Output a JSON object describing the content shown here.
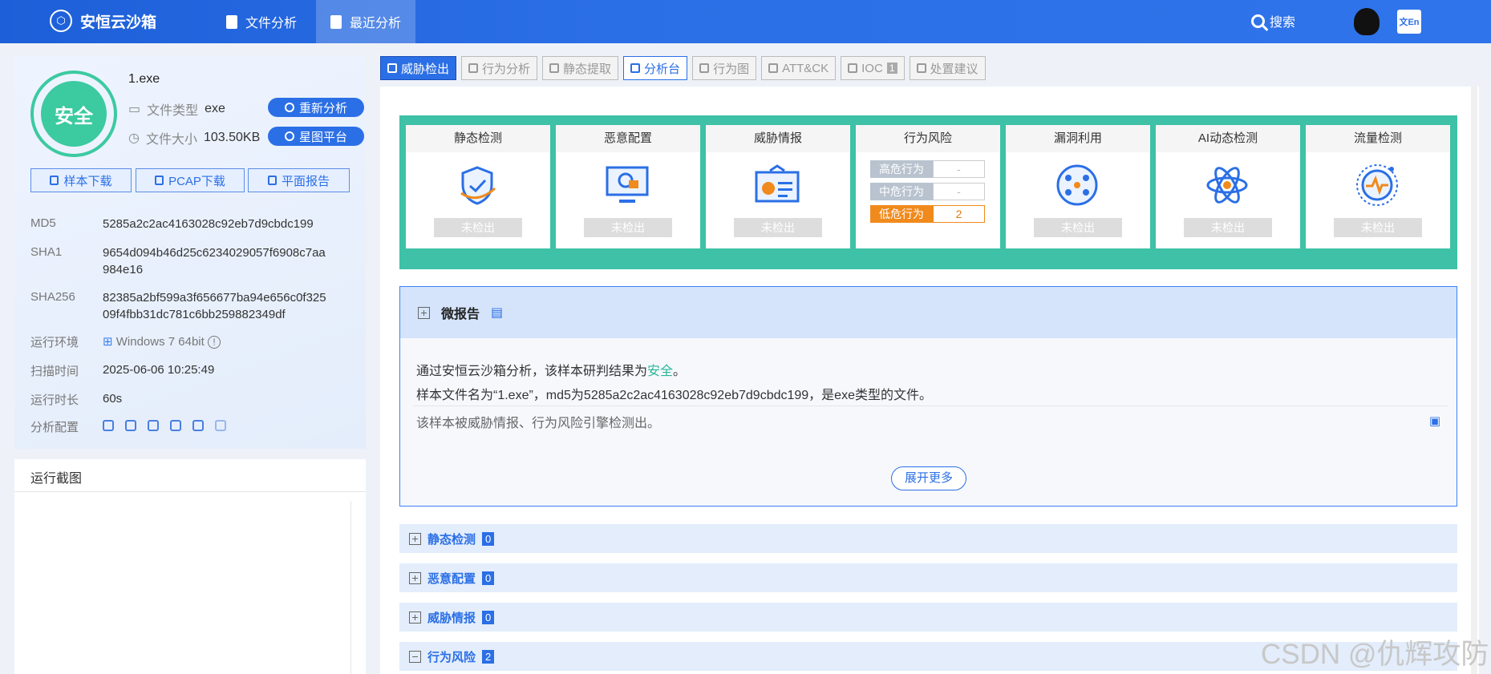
{
  "header": {
    "brand": "安恒云沙箱",
    "nav": [
      {
        "label": "文件分析"
      },
      {
        "label": "最近分析"
      }
    ],
    "search": "搜索",
    "lang": "文En"
  },
  "file": {
    "badge": "安全",
    "name": "1.exe",
    "type_label": "文件类型",
    "type_value": "exe",
    "size_label": "文件大小",
    "size_value": "103.50KB",
    "reanalyze": "重新分析",
    "platform": "星图平台"
  },
  "downloads": [
    "样本下载",
    "PCAP下载",
    "平面报告"
  ],
  "info": [
    {
      "k": "MD5",
      "v": "5285a2c2ac4163028c92eb7d9cbdc199"
    },
    {
      "k": "SHA1",
      "v": "9654d094b46d25c6234029057f6908c7aa 984e16"
    },
    {
      "k": "SHA256",
      "v": "82385a2bf599a3f656677ba94e656c0f325 09f4fbb31dc781c6bb259882349df"
    },
    {
      "k": "运行环境",
      "v": "Windows 7 64bit"
    },
    {
      "k": "扫描时间",
      "v": "2025-06-06 10:25:49"
    },
    {
      "k": "运行时长",
      "v": "60s"
    },
    {
      "k": "分析配置",
      "v": ""
    }
  ],
  "screenshot_title": "运行截图",
  "tabs": [
    "威胁检出",
    "行为分析",
    "静态提取",
    "分析台",
    "行为图",
    "ATT&CK",
    "IOC",
    "处置建议"
  ],
  "ioc_count": "1",
  "cards": [
    {
      "title": "静态检测",
      "status": "未检出"
    },
    {
      "title": "恶意配置",
      "status": "未检出"
    },
    {
      "title": "威胁情报",
      "status": "未检出"
    },
    {
      "title": "行为风险",
      "status": ""
    },
    {
      "title": "漏洞利用",
      "status": "未检出"
    },
    {
      "title": "AI动态检测",
      "status": "未检出"
    },
    {
      "title": "流量检测",
      "status": "未检出"
    }
  ],
  "behavior_risk": [
    {
      "label": "高危行为",
      "value": "-"
    },
    {
      "label": "中危行为",
      "value": "-"
    },
    {
      "label": "低危行为",
      "value": "2"
    }
  ],
  "mini_report": {
    "title": "微报告",
    "p1_pre": "通过安恒云沙箱分析，该样本研判结果为",
    "p1_verdict": "安全",
    "p1_post": "。",
    "p2": "样本文件名为“1.exe”，md5为5285a2c2ac4163028c92eb7d9cbdc199，是exe类型的文件。",
    "p3": "该样本被威胁情报、行为风险引擎检测出。",
    "more": "展开更多"
  },
  "sections": [
    {
      "label": "静态检测",
      "count": "0"
    },
    {
      "label": "恶意配置",
      "count": "0"
    },
    {
      "label": "威胁情报",
      "count": "0"
    },
    {
      "label": "行为风险",
      "count": "2"
    }
  ],
  "watermark": "CSDN @仇辉攻防"
}
